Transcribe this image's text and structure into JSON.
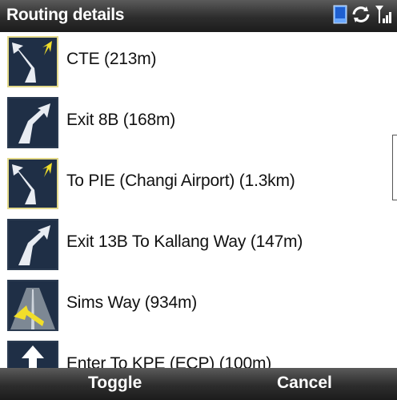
{
  "title": "Routing details",
  "status_icons": [
    "device-icon",
    "sync-icon",
    "signal-icon"
  ],
  "routes": [
    {
      "label": "CTE (213m)",
      "icon": "keep-left-ramp-icon"
    },
    {
      "label": "Exit 8B (168m)",
      "icon": "exit-right-icon"
    },
    {
      "label": "To PIE (Changi Airport) (1.3km)",
      "icon": "keep-left-ramp-icon"
    },
    {
      "label": "Exit 13B To Kallang Way (147m)",
      "icon": "exit-right-icon"
    },
    {
      "label": "Sims Way (934m)",
      "icon": "merge-road-icon"
    },
    {
      "label": "Enter To KPE (ECP) (100m)",
      "icon": "straight-arrow-icon"
    }
  ],
  "softkeys": {
    "left": "Toggle",
    "right": "Cancel"
  },
  "colors": {
    "bar": "#2d2d2d",
    "icon_bg": "#1f2f46",
    "highlight_border": "#e3d98a"
  }
}
